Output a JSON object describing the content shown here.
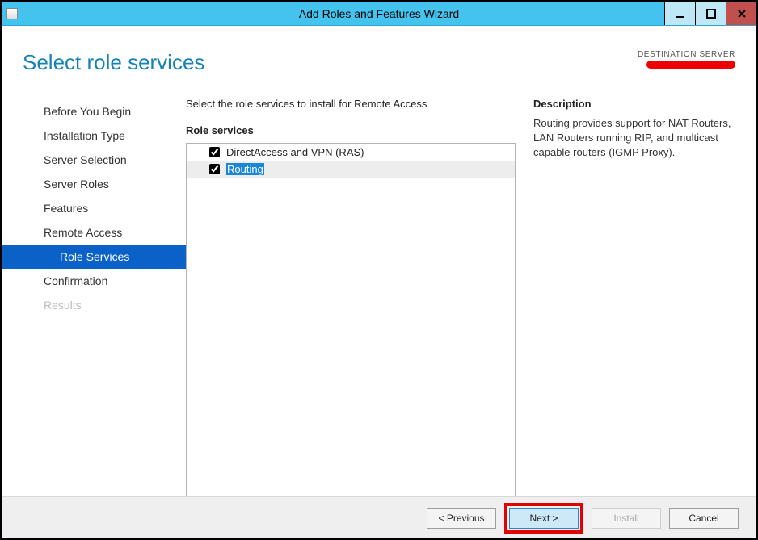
{
  "window": {
    "title": "Add Roles and Features Wizard"
  },
  "header": {
    "page_title": "Select role services",
    "destination_label": "DESTINATION SERVER"
  },
  "nav": {
    "items": [
      {
        "label": "Before You Begin",
        "sub": false,
        "selected": false,
        "disabled": false
      },
      {
        "label": "Installation Type",
        "sub": false,
        "selected": false,
        "disabled": false
      },
      {
        "label": "Server Selection",
        "sub": false,
        "selected": false,
        "disabled": false
      },
      {
        "label": "Server Roles",
        "sub": false,
        "selected": false,
        "disabled": false
      },
      {
        "label": "Features",
        "sub": false,
        "selected": false,
        "disabled": false
      },
      {
        "label": "Remote Access",
        "sub": false,
        "selected": false,
        "disabled": false
      },
      {
        "label": "Role Services",
        "sub": true,
        "selected": true,
        "disabled": false
      },
      {
        "label": "Confirmation",
        "sub": false,
        "selected": false,
        "disabled": false
      },
      {
        "label": "Results",
        "sub": false,
        "selected": false,
        "disabled": true
      }
    ]
  },
  "body": {
    "instruction": "Select the role services to install for Remote Access",
    "role_services_heading": "Role services",
    "role_services": [
      {
        "label": "DirectAccess and VPN (RAS)",
        "checked": true,
        "selected": false
      },
      {
        "label": "Routing",
        "checked": true,
        "selected": true
      }
    ],
    "description_heading": "Description",
    "description_text": "Routing provides support for NAT Routers, LAN Routers running RIP, and multicast capable routers (IGMP Proxy)."
  },
  "footer": {
    "previous": "< Previous",
    "next": "Next >",
    "install": "Install",
    "cancel": "Cancel"
  }
}
